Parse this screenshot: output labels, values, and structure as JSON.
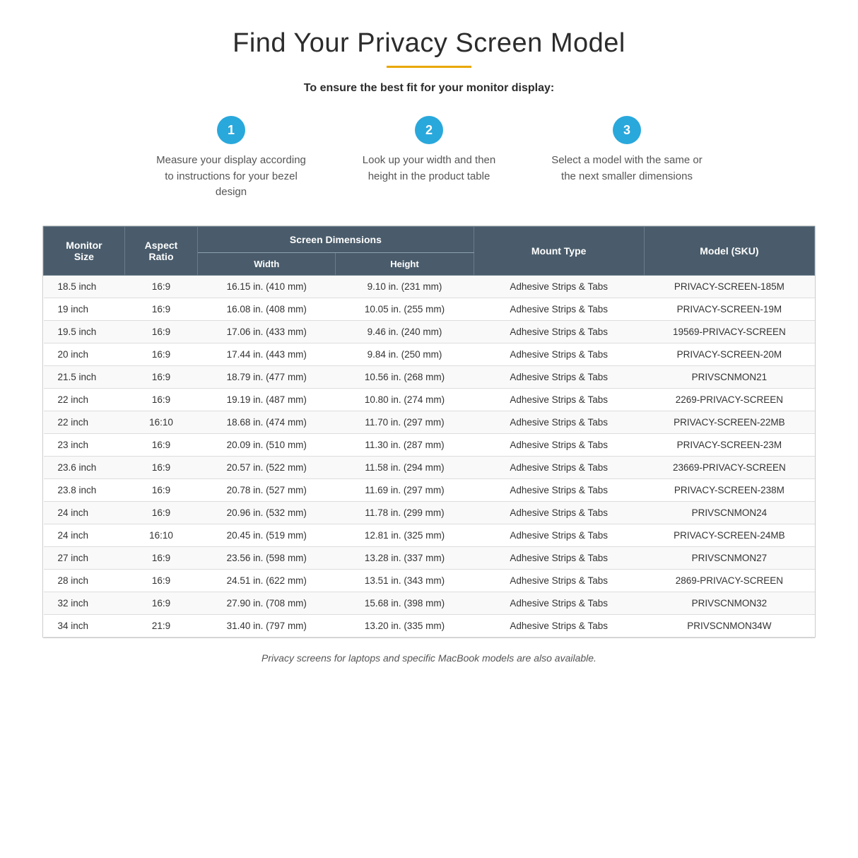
{
  "page": {
    "title": "Find Your Privacy Screen Model",
    "divider_color": "#e8a800",
    "subtitle": "To ensure the best fit for your monitor display:",
    "steps": [
      {
        "number": "1",
        "text": "Measure your display according to instructions for your bezel design"
      },
      {
        "number": "2",
        "text": "Look up your width and then height in the product table"
      },
      {
        "number": "3",
        "text": "Select a model with the same or the next smaller dimensions"
      }
    ],
    "table": {
      "headers": {
        "monitor_size": "Monitor\nSize",
        "aspect_ratio": "Aspect\nRatio",
        "screen_dimensions": "Screen Dimensions",
        "width": "Width",
        "height": "Height",
        "mount_type": "Mount Type",
        "model_sku": "Model (SKU)"
      },
      "rows": [
        {
          "size": "18.5 inch",
          "aspect": "16:9",
          "width": "16.15 in. (410 mm)",
          "height": "9.10 in. (231 mm)",
          "mount": "Adhesive Strips & Tabs",
          "model": "PRIVACY-SCREEN-185M"
        },
        {
          "size": "19 inch",
          "aspect": "16:9",
          "width": "16.08 in. (408 mm)",
          "height": "10.05 in. (255 mm)",
          "mount": "Adhesive Strips & Tabs",
          "model": "PRIVACY-SCREEN-19M"
        },
        {
          "size": "19.5 inch",
          "aspect": "16:9",
          "width": "17.06 in. (433 mm)",
          "height": "9.46 in. (240 mm)",
          "mount": "Adhesive Strips & Tabs",
          "model": "19569-PRIVACY-SCREEN"
        },
        {
          "size": "20 inch",
          "aspect": "16:9",
          "width": "17.44 in. (443 mm)",
          "height": "9.84 in. (250 mm)",
          "mount": "Adhesive Strips & Tabs",
          "model": "PRIVACY-SCREEN-20M"
        },
        {
          "size": "21.5 inch",
          "aspect": "16:9",
          "width": "18.79 in. (477 mm)",
          "height": "10.56 in. (268 mm)",
          "mount": "Adhesive Strips & Tabs",
          "model": "PRIVSCNMON21"
        },
        {
          "size": "22 inch",
          "aspect": "16:9",
          "width": "19.19 in. (487 mm)",
          "height": "10.80 in. (274 mm)",
          "mount": "Adhesive Strips & Tabs",
          "model": "2269-PRIVACY-SCREEN"
        },
        {
          "size": "22 inch",
          "aspect": "16:10",
          "width": "18.68 in. (474 mm)",
          "height": "11.70 in. (297 mm)",
          "mount": "Adhesive Strips & Tabs",
          "model": "PRIVACY-SCREEN-22MB"
        },
        {
          "size": "23 inch",
          "aspect": "16:9",
          "width": "20.09 in. (510 mm)",
          "height": "11.30 in. (287 mm)",
          "mount": "Adhesive Strips & Tabs",
          "model": "PRIVACY-SCREEN-23M"
        },
        {
          "size": "23.6 inch",
          "aspect": "16:9",
          "width": "20.57 in. (522 mm)",
          "height": "11.58 in. (294 mm)",
          "mount": "Adhesive Strips & Tabs",
          "model": "23669-PRIVACY-SCREEN"
        },
        {
          "size": "23.8 inch",
          "aspect": "16:9",
          "width": "20.78 in. (527 mm)",
          "height": "11.69 in. (297 mm)",
          "mount": "Adhesive Strips & Tabs",
          "model": "PRIVACY-SCREEN-238M"
        },
        {
          "size": "24 inch",
          "aspect": "16:9",
          "width": "20.96 in. (532 mm)",
          "height": "11.78 in. (299 mm)",
          "mount": "Adhesive Strips & Tabs",
          "model": "PRIVSCNMON24"
        },
        {
          "size": "24 inch",
          "aspect": "16:10",
          "width": "20.45 in. (519 mm)",
          "height": "12.81 in. (325 mm)",
          "mount": "Adhesive Strips & Tabs",
          "model": "PRIVACY-SCREEN-24MB"
        },
        {
          "size": "27 inch",
          "aspect": "16:9",
          "width": "23.56 in. (598 mm)",
          "height": "13.28 in. (337 mm)",
          "mount": "Adhesive Strips & Tabs",
          "model": "PRIVSCNMON27"
        },
        {
          "size": "28 inch",
          "aspect": "16:9",
          "width": "24.51 in. (622 mm)",
          "height": "13.51 in. (343 mm)",
          "mount": "Adhesive Strips & Tabs",
          "model": "2869-PRIVACY-SCREEN"
        },
        {
          "size": "32 inch",
          "aspect": "16:9",
          "width": "27.90 in. (708 mm)",
          "height": "15.68 in. (398 mm)",
          "mount": "Adhesive Strips & Tabs",
          "model": "PRIVSCNMON32"
        },
        {
          "size": "34 inch",
          "aspect": "21:9",
          "width": "31.40 in. (797 mm)",
          "height": "13.20 in. (335 mm)",
          "mount": "Adhesive Strips & Tabs",
          "model": "PRIVSCNMON34W"
        }
      ]
    },
    "footer_note": "Privacy screens for laptops and specific MacBook models are also available."
  }
}
